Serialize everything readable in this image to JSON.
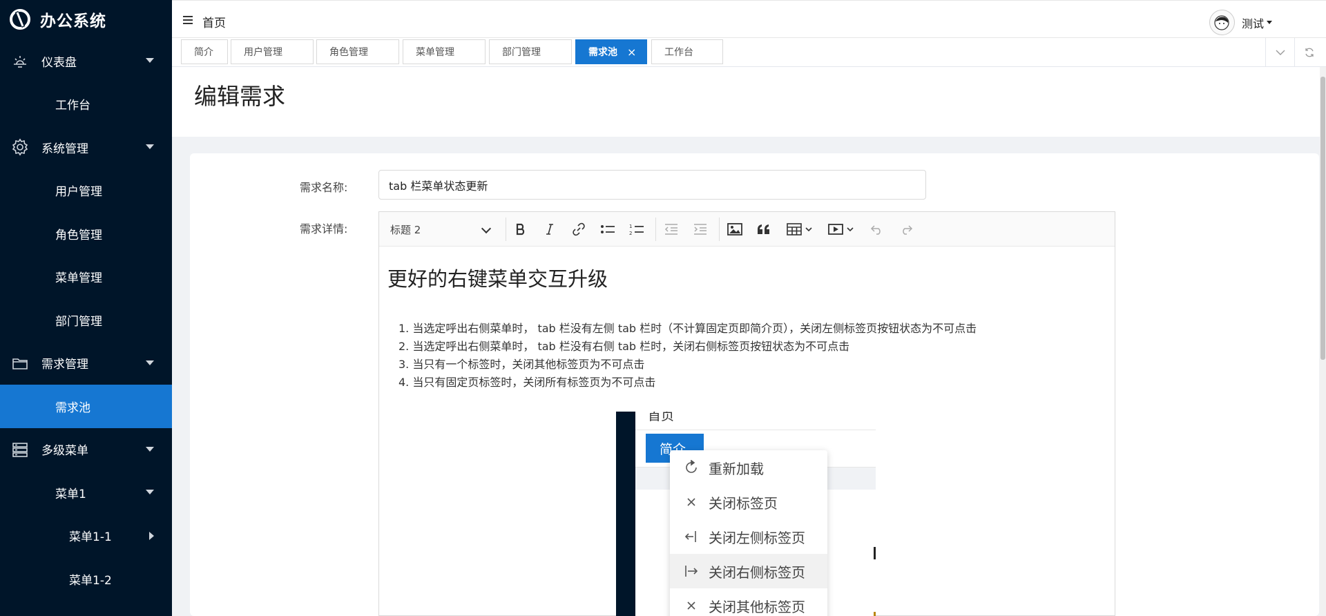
{
  "app": {
    "logo_text": "办公系统"
  },
  "sidebar": {
    "groups": [
      {
        "label": "仪表盘",
        "icon": "sunrise-icon"
      },
      {
        "label": "工作台"
      },
      {
        "label": "系统管理",
        "icon": "gear-icon"
      },
      {
        "label": "用户管理"
      },
      {
        "label": "角色管理"
      },
      {
        "label": "菜单管理"
      },
      {
        "label": "部门管理"
      },
      {
        "label": "需求管理",
        "icon": "folder-icon"
      },
      {
        "label": "需求池"
      },
      {
        "label": "多级菜单",
        "icon": "server-icon"
      },
      {
        "label": "菜单1"
      },
      {
        "label": "菜单1-1"
      },
      {
        "label": "菜单1-2"
      }
    ]
  },
  "header": {
    "breadcrumb": "首页",
    "username": "测试"
  },
  "tabs": [
    {
      "label": "简介"
    },
    {
      "label": "用户管理"
    },
    {
      "label": "角色管理"
    },
    {
      "label": "菜单管理"
    },
    {
      "label": "部门管理"
    },
    {
      "label": "需求池",
      "close": "×"
    },
    {
      "label": "工作台"
    }
  ],
  "page": {
    "title": "编辑需求"
  },
  "form": {
    "name_label": "需求名称:",
    "name_value": "tab 栏菜单状态更新",
    "detail_label": "需求详情:"
  },
  "editor": {
    "heading_select": "标题 2",
    "heading": "更好的右键菜单交互升级",
    "list": [
      "1. 当选定呼出右侧菜单时， tab 栏没有左侧 tab 栏时（不计算固定页即简介页），关闭左侧标签页按钮状态为不可点击",
      "2. 当选定呼出右侧菜单时， tab 栏没有右侧 tab 栏时，关闭右侧标签页按钮状态为不可点击",
      "3. 当只有一个标签时，关闭其他标签页为不可点击",
      "4. 当只有固定页标签时，关闭所有标签页为不可点击"
    ],
    "image": {
      "crumb": "首页",
      "tab": "简介",
      "menu": [
        "重新加载",
        "关闭标签页",
        "关闭左侧标签页",
        "关闭右侧标签页",
        "关闭其他标签页"
      ]
    }
  },
  "colors": {
    "sidebar_bg": "#001529",
    "accent": "#1677d2"
  }
}
